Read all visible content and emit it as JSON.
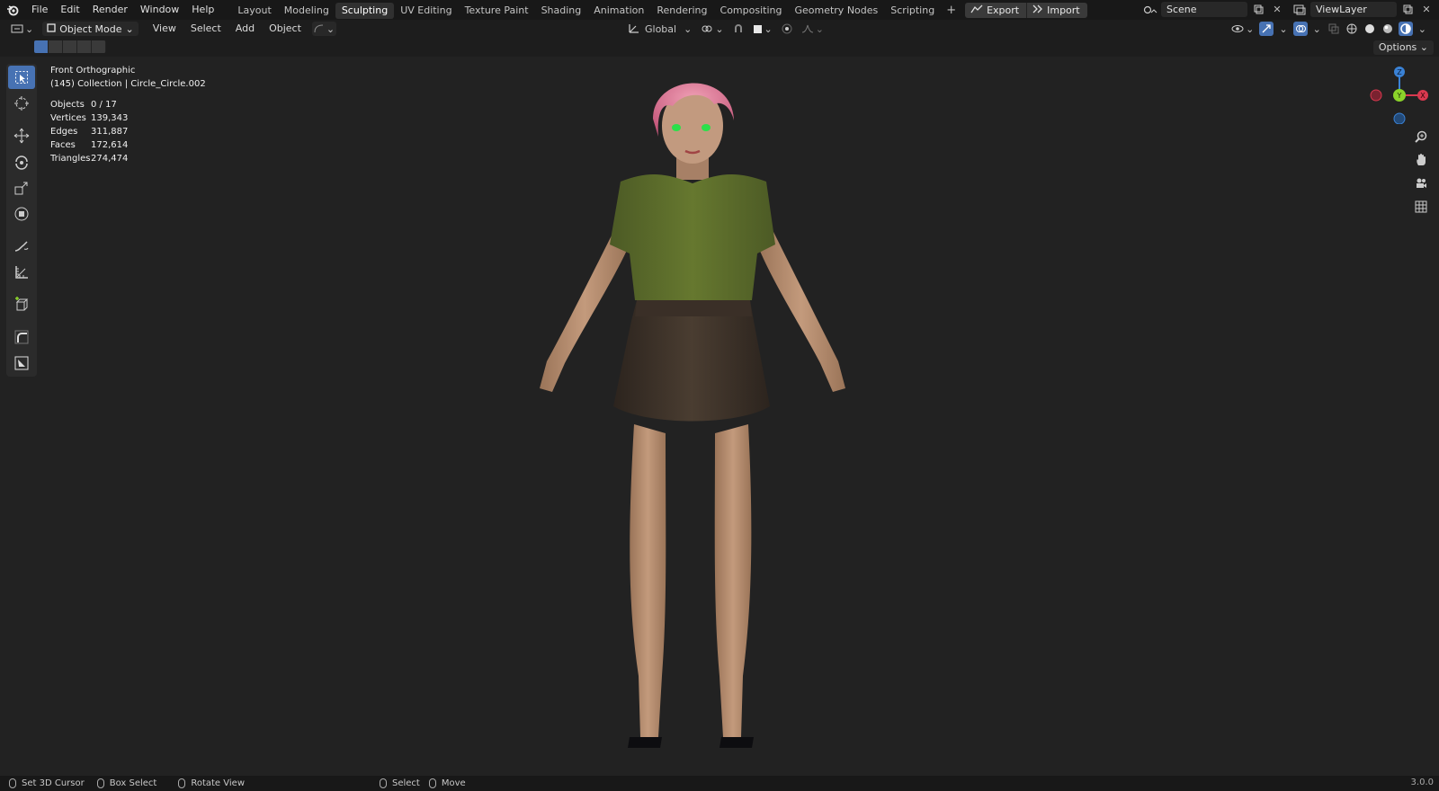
{
  "topbar": {
    "menu": [
      "File",
      "Edit",
      "Render",
      "Window",
      "Help"
    ],
    "workspaces": [
      {
        "label": "Layout",
        "active": false
      },
      {
        "label": "Modeling",
        "active": false
      },
      {
        "label": "Sculpting",
        "active": true
      },
      {
        "label": "UV Editing",
        "active": false
      },
      {
        "label": "Texture Paint",
        "active": false
      },
      {
        "label": "Shading",
        "active": false
      },
      {
        "label": "Animation",
        "active": false
      },
      {
        "label": "Rendering",
        "active": false
      },
      {
        "label": "Compositing",
        "active": false
      },
      {
        "label": "Geometry Nodes",
        "active": false
      },
      {
        "label": "Scripting",
        "active": false
      }
    ],
    "add_tab": "+",
    "export_label": "Export",
    "import_label": "Import",
    "scene_name": "Scene",
    "view_layer": "ViewLayer"
  },
  "header": {
    "mode": "Object Mode",
    "menus": [
      "View",
      "Select",
      "Add",
      "Object"
    ],
    "transform_orientation": "Global"
  },
  "options_label": "Options",
  "viewport": {
    "view_name": "Front Orthographic",
    "collection_info": "(145) Collection | Circle_Circle.002",
    "stats": [
      {
        "label": "Objects",
        "value": "0 / 17"
      },
      {
        "label": "Vertices",
        "value": "139,343"
      },
      {
        "label": "Edges",
        "value": "311,887"
      },
      {
        "label": "Faces",
        "value": "172,614"
      },
      {
        "label": "Triangles",
        "value": "274,474"
      }
    ],
    "gizmo": {
      "z": "Z",
      "y": "Y",
      "x": "X"
    }
  },
  "toolbar_tools": [
    "select-box",
    "cursor",
    "move",
    "rotate",
    "scale",
    "transform",
    "annotate",
    "measure",
    "add-cube",
    "shear",
    "extrude"
  ],
  "statusbar": {
    "items": [
      "Set 3D Cursor",
      "Box Select",
      "Rotate View",
      "Select",
      "Move"
    ],
    "version": "3.0.0"
  },
  "colors": {
    "accent": "#4772b3",
    "axis_x": "#d9394f",
    "axis_y": "#8bd32a",
    "axis_z": "#3a82d6"
  }
}
